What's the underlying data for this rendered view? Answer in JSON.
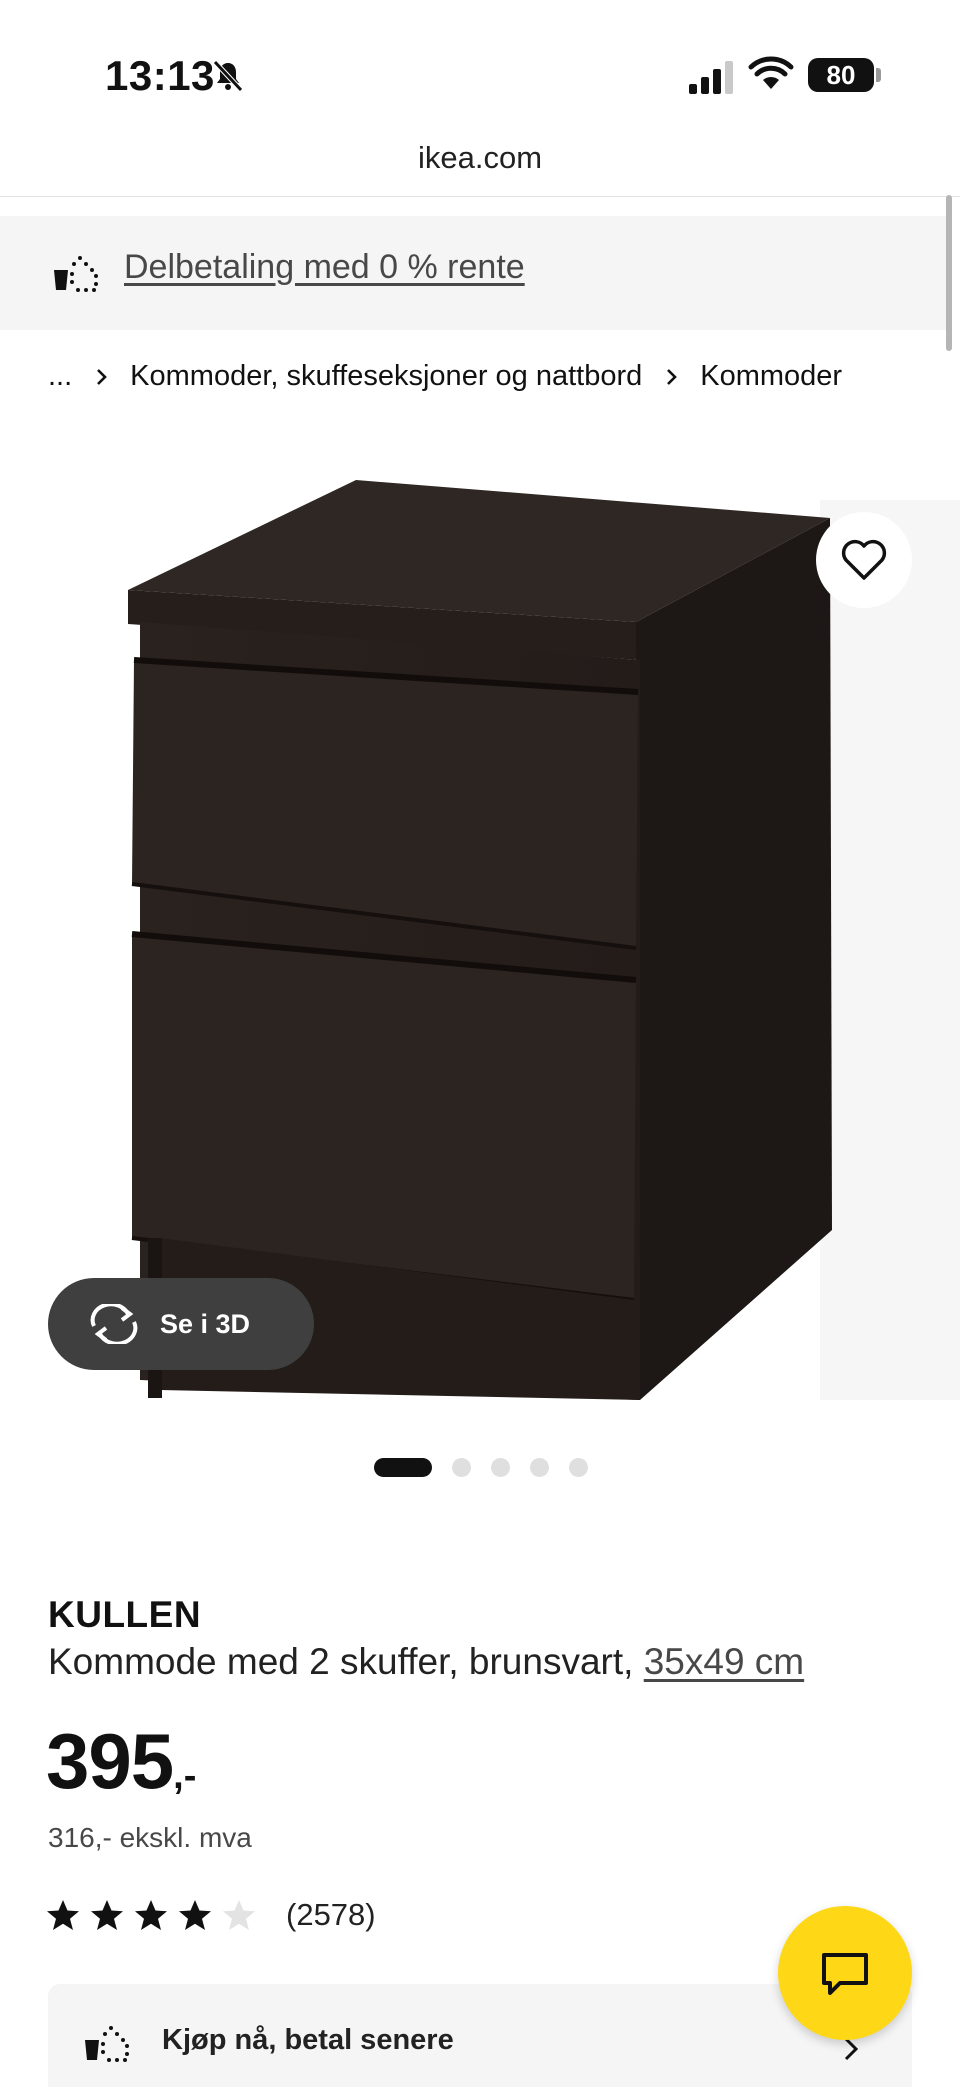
{
  "status_bar": {
    "time": "13:13",
    "battery": "80",
    "icons": [
      "bell-slash-icon",
      "signal-icon",
      "wifi-icon",
      "battery-icon"
    ]
  },
  "browser": {
    "url": "ikea.com"
  },
  "promo": {
    "label": "Delbetaling med 0 % rente",
    "icon": "basket-dots-icon"
  },
  "breadcrumb": {
    "items": [
      "...",
      "Kommoder, skuffeseksjoner og nattbord",
      "Kommoder"
    ]
  },
  "gallery": {
    "view3d_label": "Se i 3D",
    "image_count": 5,
    "active_index": 0
  },
  "product": {
    "name": "KULLEN",
    "description": "Kommode med 2 skuffer, brunsvart, ",
    "size": "35x49 cm",
    "price": "395",
    "price_suffix": ",-",
    "price_ex_vat": "316,- ekskl. mva",
    "rating": 4,
    "rating_max": 5,
    "review_count": "(2578)"
  },
  "bnpl": {
    "label": "Kjøp nå, betal senere"
  },
  "colors": {
    "accent_yellow": "#fed816",
    "promo_bg": "#f5f5f5",
    "furniture": "#2b2420",
    "text": "#111111"
  }
}
